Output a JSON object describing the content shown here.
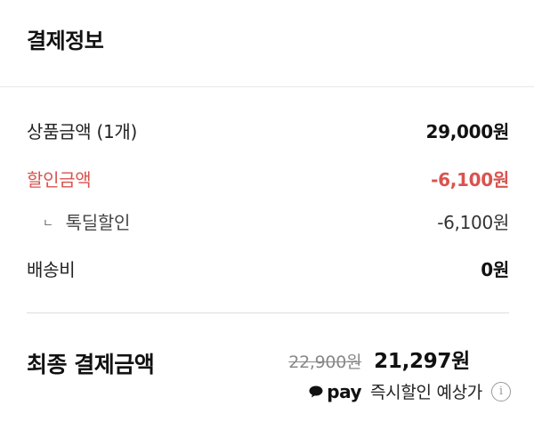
{
  "header": {
    "title": "결제정보"
  },
  "rows": [
    {
      "label": "상품금액 (1개)",
      "value": "29,000원"
    },
    {
      "label": "할인금액",
      "value": "-6,100원"
    },
    {
      "bullet": "ㄴ",
      "label": "톡딜할인",
      "value": "-6,100원"
    },
    {
      "label": "배송비",
      "value": "0원"
    }
  ],
  "final": {
    "label": "최종 결제금액",
    "original_price": "22,900원",
    "price": "21,297원"
  },
  "pay": {
    "logo": "pay",
    "text": "즉시할인 예상가",
    "info_glyph": "i"
  },
  "colors": {
    "discount": "#d9534f",
    "text": "#222222",
    "divider": "#dddddd"
  },
  "icons": [
    "speech-bubble-icon",
    "info-icon"
  ]
}
